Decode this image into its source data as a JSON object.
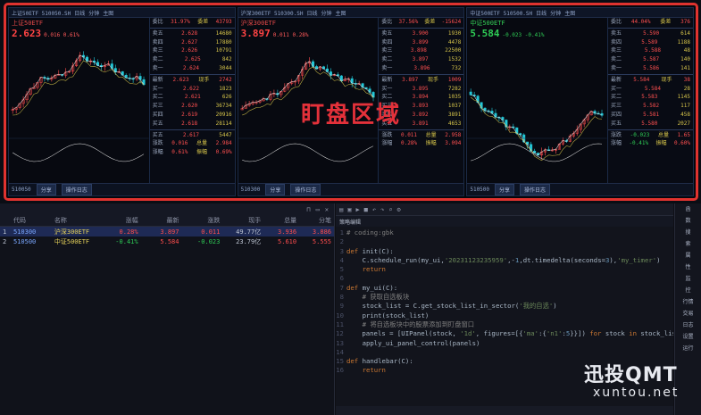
{
  "monitor": {
    "overlay_text": "盯盘区域",
    "panels": [
      {
        "name": "上证50ETF",
        "code": "510050",
        "title": "上证50ETF 510050.SH",
        "price": "2.623",
        "change": "0.016 0.61%",
        "up": true,
        "book": [
          [
            "委比",
            "31.97%",
            "委差",
            "43793"
          ],
          [
            "卖五",
            "2.628",
            "14680",
            ""
          ],
          [
            "卖四",
            "2.627",
            "17880",
            ""
          ],
          [
            "卖三",
            "2.626",
            "10791",
            ""
          ],
          [
            "卖二",
            "2.625",
            "842",
            ""
          ],
          [
            "卖一",
            "2.624",
            "3044",
            ""
          ],
          [
            "最新",
            "2.623",
            "现手",
            "2742"
          ],
          [
            "买一",
            "2.622",
            "1823",
            ""
          ],
          [
            "买二",
            "2.621",
            "626",
            ""
          ],
          [
            "买三",
            "2.620",
            "36734",
            ""
          ],
          [
            "买四",
            "2.619",
            "20916",
            ""
          ],
          [
            "买五",
            "2.618",
            "28114",
            ""
          ],
          [
            "买五",
            "2.617",
            "5447",
            ""
          ],
          [
            "涨跌",
            "0.016",
            "总量",
            "2.984"
          ],
          [
            "涨幅",
            "0.61%",
            "振幅",
            "0.69%"
          ]
        ],
        "footer_btns": [
          "分享",
          "操作日志"
        ]
      },
      {
        "name": "沪深300ETF",
        "code": "510300",
        "title": "沪深300ETF 510300.SH",
        "price": "3.897",
        "change": "0.011 0.28%",
        "up": true,
        "book": [
          [
            "委比",
            "37.56%",
            "委差",
            "-15624"
          ],
          [
            "卖五",
            "3.900",
            "1930",
            ""
          ],
          [
            "卖四",
            "3.899",
            "4478",
            ""
          ],
          [
            "卖三",
            "3.898",
            "22500",
            ""
          ],
          [
            "卖二",
            "3.897",
            "1532",
            ""
          ],
          [
            "卖一",
            "3.896",
            "732",
            ""
          ],
          [
            "最新",
            "3.897",
            "现手",
            "1009"
          ],
          [
            "买一",
            "3.895",
            "7282",
            ""
          ],
          [
            "买二",
            "3.894",
            "1035",
            ""
          ],
          [
            "买三",
            "3.893",
            "1037",
            ""
          ],
          [
            "买四",
            "3.892",
            "3891",
            ""
          ],
          [
            "买五",
            "3.891",
            "4653",
            ""
          ],
          [
            "涨跌",
            "0.011",
            "总量",
            "2.958"
          ],
          [
            "涨幅",
            "0.28%",
            "振幅",
            "3.094"
          ]
        ],
        "footer_btns": [
          "分享",
          "操作日志"
        ]
      },
      {
        "name": "中证500ETF",
        "code": "510500",
        "title": "中证500ETF 510500.SH",
        "price": "5.584",
        "change": "-0.023 -0.41%",
        "up": false,
        "book": [
          [
            "委比",
            "44.04%",
            "委差",
            "376"
          ],
          [
            "卖五",
            "5.590",
            "614",
            ""
          ],
          [
            "卖四",
            "5.589",
            "1188",
            ""
          ],
          [
            "卖三",
            "5.588",
            "48",
            ""
          ],
          [
            "卖二",
            "5.587",
            "140",
            ""
          ],
          [
            "卖一",
            "5.586",
            "141",
            ""
          ],
          [
            "最新",
            "5.584",
            "现手",
            "38"
          ],
          [
            "买一",
            "5.584",
            "28",
            ""
          ],
          [
            "买二",
            "5.583",
            "1145",
            ""
          ],
          [
            "买三",
            "5.582",
            "117",
            ""
          ],
          [
            "买四",
            "5.581",
            "458",
            ""
          ],
          [
            "买五",
            "5.580",
            "2027",
            ""
          ],
          [
            "涨跌",
            "-0.023",
            "总量",
            "1.65"
          ],
          [
            "涨幅",
            "-0.41%",
            "振幅",
            "0.60%"
          ]
        ],
        "footer_btns": [
          "分享",
          "操作日志"
        ]
      }
    ],
    "toolbar_items": [
      "日线",
      "分钟",
      "主图"
    ]
  },
  "list": {
    "headers": [
      "",
      "代码",
      "名称",
      "涨幅",
      "最新",
      "涨跌",
      "现手",
      "总量",
      "分笔"
    ],
    "rows": [
      [
        "1",
        "510300",
        "沪深300ETF",
        "0.28%",
        "3.897",
        "0.011",
        "49.77亿",
        "3.936",
        "3.886"
      ],
      [
        "2",
        "510500",
        "中证500ETF",
        "-0.41%",
        "5.584",
        "-0.023",
        "23.79亿",
        "5.610",
        "5.555"
      ]
    ]
  },
  "editor": {
    "tab_label": "策略编辑",
    "status": "",
    "lines": [
      "# coding:gbk",
      "",
      "def init(C):",
      "    C.schedule_run(my_ui,'20231123235959',-1,dt.timedelta(seconds=3),'my_timer')",
      "    return",
      "",
      "def my_ui(C):",
      "    # 获取自选板块",
      "    stock_list = C.get_stock_list_in_sector('我的自选')",
      "    print(stock_list)",
      "    # 将自选板块中的股票添加到盯盘窗口",
      "    panels = [UIPanel(stock, '1d', figures=[{'ma':{'n1':5}}]) for stock in stock_list]",
      "    apply_ui_panel_control(panels)",
      "",
      "def handlebar(C):",
      "    return"
    ]
  },
  "right_panel": {
    "items": [
      "函",
      "数",
      "搜",
      "索",
      "属",
      "性",
      "监",
      "控",
      "行情",
      "交易",
      "日志",
      "设置",
      "运行"
    ]
  },
  "watermark": {
    "line1": "迅投QMT",
    "line2": "xuntou.net"
  },
  "colors": {
    "frame": "#e0332f",
    "up": "#ff4d4d",
    "down": "#2ecc55",
    "accent": "#7aa7ff"
  }
}
